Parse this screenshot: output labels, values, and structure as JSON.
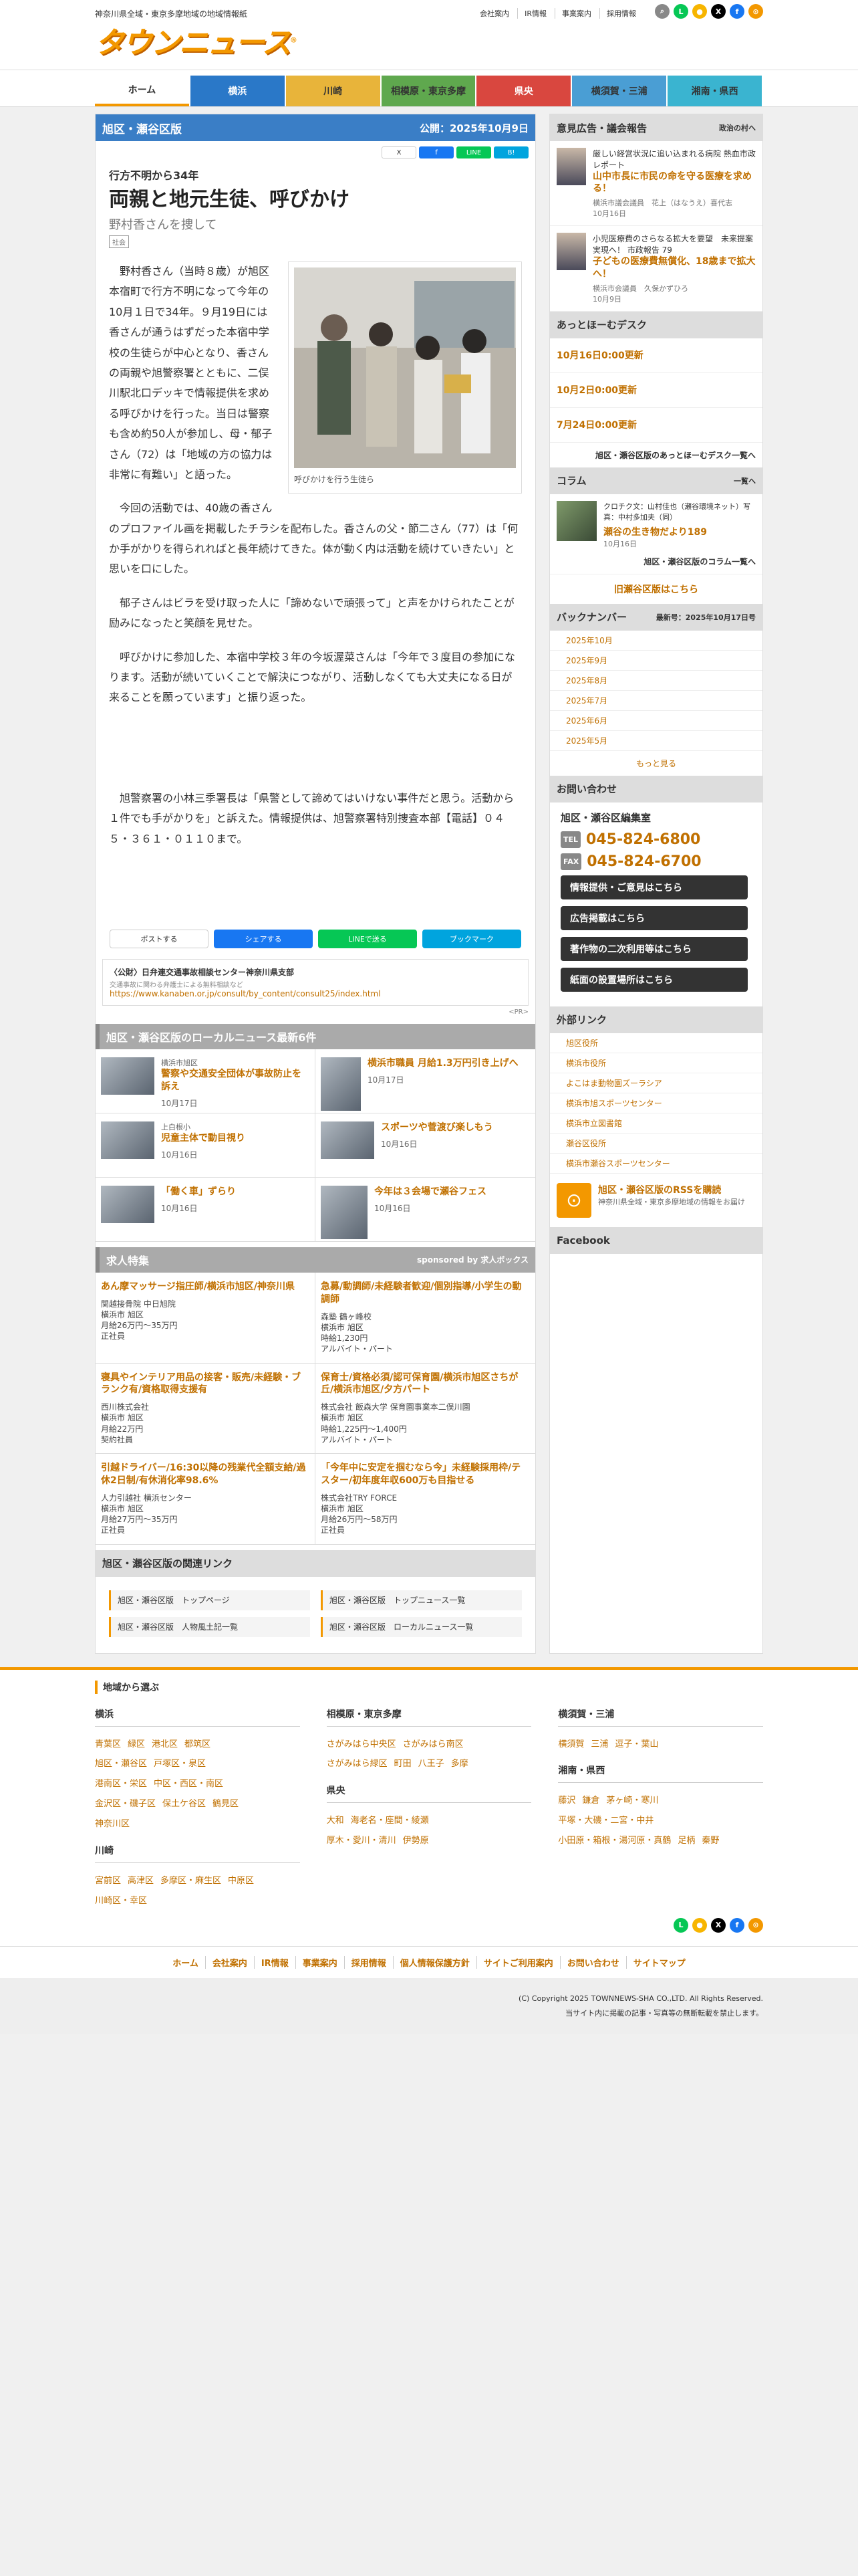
{
  "header": {
    "tagline": "神奈川県全域・東京多摩地域の地域情報紙",
    "logo": "タウンニュース",
    "logo_mark": "®",
    "links": [
      "会社案内",
      "IR情報",
      "事業案内",
      "採用情報"
    ]
  },
  "nav": {
    "items": [
      {
        "label": "ホーム",
        "color": "#ffffff"
      },
      {
        "label": "横浜",
        "color": "#2a78c8"
      },
      {
        "label": "川崎",
        "color": "#e8b43a"
      },
      {
        "label": "相模原・東京多摩",
        "color": "#5fa84e"
      },
      {
        "label": "県央",
        "color": "#d9473f"
      },
      {
        "label": "横須賀・三浦",
        "color": "#4a9ed4"
      },
      {
        "label": "湘南・県西",
        "color": "#3ab4d0"
      }
    ]
  },
  "article": {
    "edition": "旭区・瀬谷区版",
    "published": "公開：2025年10月9日",
    "share_mini": [
      "X",
      "f",
      "LINE",
      "B!"
    ],
    "subhead": "行方不明から34年",
    "title": "両親と地元生徒、呼びかけ",
    "lead": "野村香さんを捜して",
    "badge": "社会",
    "photo_caption": "呼びかけを行う生徒ら",
    "paragraphs": [
      "野村香さん（当時８歳）が旭区本宿町で行方不明になって今年の10月１日で34年。９月19日には香さんが通うはずだった本宿中学校の生徒らが中心となり、香さんの両親や旭警察署とともに、二俣川駅北口デッキで情報提供を求める呼びかけを行った。当日は警察も含め約50人が参加し、母・郁子さん（72）は「地域の方の協力は非常に有難い」と語った。",
      "今回の活動では、40歳の香さんのプロファイル画を掲載したチラシを配布した。香さんの父・節二さん（77）は「何か手がかりを得られればと長年続けてきた。体が動く内は活動を続けていきたい」と思いを口にした。",
      "郁子さんはビラを受け取った人に「諦めないで頑張って」と声をかけられたことが励みになったと笑顔を見せた。",
      "呼びかけに参加した、本宿中学校３年の今坂渥菜さんは「今年で３度目の参加になります。活動が続いていくことで解決につながり、活動しなくても大丈夫になる日が来ることを願っています」と振り返った。",
      "旭警察署の小林三季署長は「県警として諦めてはいけない事件だと思う。活動から１件でも手がかりを」と訴えた。情報提供は、旭警察署特別捜査本部【電話】０４５・３６１・０１１０まで。"
    ],
    "share_big": [
      "ポストする",
      "シェアする",
      "LINEで送る",
      "ブックマーク"
    ]
  },
  "ad": {
    "title": "〈公財〉日弁連交通事故相談センター神奈川県支部",
    "note": "交通事故に関わる弁護士による無料相談など",
    "url": "https://www.kanaben.or.jp/consult/by_content/consult25/index.html",
    "pr": "<PR>"
  },
  "local_news": {
    "heading": "旭区・瀬谷区版のローカルニュース最新6件",
    "items": [
      {
        "src": "横浜市旭区",
        "title": "警察や交通安全団体が事故防止を訴え",
        "date": "10月17日"
      },
      {
        "src": "",
        "title": "横浜市職員 月給1.3万円引き上げへ",
        "date": "10月17日"
      },
      {
        "src": "上白根小",
        "title": "児童主体で動目視り",
        "date": "10月16日"
      },
      {
        "src": "",
        "title": "スポーツや菅渡び楽しもう",
        "date": "10月16日"
      },
      {
        "src": "",
        "title": "「働く車」ずらり",
        "date": "10月16日"
      },
      {
        "src": "",
        "title": "今年は３会場で瀬谷フェス",
        "date": "10月16日"
      }
    ]
  },
  "jobs": {
    "heading": "求人特集",
    "sponsor": "sponsored by 求人ボックス",
    "items": [
      {
        "title": "あん摩マッサージ指圧師/横浜市旭区/神奈川県",
        "company": "関越接骨院 中日旭院",
        "loc": "横浜市 旭区",
        "pay": "月給26万円～35万円",
        "type": "正社員"
      },
      {
        "title": "急募/動調師/未経験者歓迎/個別指導/小学生の動調師",
        "company": "森塾 鶴ヶ峰校",
        "loc": "横浜市 旭区",
        "pay": "時給1,230円",
        "type": "アルバイト・パート"
      },
      {
        "title": "寝具やインテリア用品の接客・販売/未経験・ブランク有/資格取得支援有",
        "company": "西川株式会社",
        "loc": "横浜市 旭区",
        "pay": "月給22万円",
        "type": "契約社員"
      },
      {
        "title": "保育士/資格必須/認可保育園/横浜市旭区さちが丘/横浜市旭区/夕方パート",
        "company": "株式会社 飯森大学 保育園事業本二俣川園",
        "loc": "横浜市 旭区",
        "pay": "時給1,225円～1,400円",
        "type": "アルバイト・パート"
      },
      {
        "title": "引越ドライバー/16:30以降の残業代全額支給/過休2日制/有休消化率98.6%",
        "company": "人力引越社 横浜センター",
        "loc": "横浜市 旭区",
        "pay": "月給27万円～35万円",
        "type": "正社員"
      },
      {
        "title": "「今年中に安定を掴むなら今」未経験採用枠/テスター/初年度年収600万も目指せる",
        "company": "株式会社TRY FORCE",
        "loc": "横浜市 旭区",
        "pay": "月給26万円～58万円",
        "type": "正社員"
      }
    ]
  },
  "related": {
    "heading": "旭区・瀬谷区版の関連リンク",
    "links": [
      "旭区・瀬谷区版　トップページ",
      "旭区・瀬谷区版　トップニュース一覧",
      "旭区・瀬谷区版　人物風土記一覧",
      "旭区・瀬谷区版　ローカルニュース一覧"
    ]
  },
  "sidebar": {
    "opinion_head": "意見広告・議会報告",
    "opinion_more": "政治の村へ",
    "opinions": [
      {
        "t1": "厳しい経営状況に追い込まれる病院 熱血市政レポート",
        "t2": "山中市長に市民の命を守る医療を求める！",
        "t3": "横浜市議会議員　花上（はなうえ）喜代志",
        "t4": "10月16日"
      },
      {
        "t1": "小児医療費のさらなる拡大を要望　未来提案実現へ！ 市政報告 79",
        "t2": "子どもの医療費無償化、18歳まで拡大へ！",
        "t3": "横浜市会議員　久保かずひろ",
        "t4": "10月9日"
      }
    ],
    "desk_head": "あっとほーむデスク",
    "desk": [
      "10月16日0:00更新",
      "10月2日0:00更新",
      "7月24日0:00更新"
    ],
    "desk_link": "旭区・瀬谷区版のあっとほーむデスク一覧へ",
    "column_head": "コラム",
    "column_more": "一覧へ",
    "column": {
      "c1": "クロチク文：山村佳也（瀬谷環境ネット）写真：中村多加夫（同）",
      "c2": "瀬谷の生き物だより189",
      "c3": "10月16日"
    },
    "column_link": "旭区・瀬谷区版のコラム一覧へ",
    "edition_link": "旧瀬谷区版はこちら",
    "backnumber_head": "バックナンバー",
    "backnumber_latest": "最新号：2025年10月17日号",
    "backnumbers": [
      "2025年10月",
      "2025年9月",
      "2025年8月",
      "2025年7月",
      "2025年6月",
      "2025年5月"
    ],
    "backnumber_more": "もっと見る",
    "contact_head": "お問い合わせ",
    "contact_name": "旭区・瀬谷区編集室",
    "tel_label": "TEL",
    "tel": "045-824-6800",
    "fax_label": "FAX",
    "fax": "045-824-6700",
    "buttons": [
      "情報提供・ご意見はこちら",
      "広告掲載はこちら",
      "著作物の二次利用等はこちら",
      "紙面の設置場所はこちら"
    ],
    "ext_head": "外部リンク",
    "ext": [
      "旭区役所",
      "横浜市役所",
      "よこはま動物園ズーラシア",
      "横浜市旭スポーツセンター",
      "横浜市立図書館",
      "瀬谷区役所",
      "横浜市瀬谷スポーツセンター"
    ],
    "rss_title": "旭区・瀬谷区版のRSSを購読",
    "rss_sub": "神奈川県全域・東京多摩地域の情報をお届け",
    "facebook_head": "Facebook"
  },
  "footer": {
    "area_head": "地域から選ぶ",
    "cols": [
      {
        "groups": [
          {
            "title": "横浜",
            "links": [
              "青葉区",
              "緑区",
              "港北区",
              "都筑区",
              "旭区・瀬谷区",
              "戸塚区・泉区",
              "港南区・栄区",
              "中区・西区・南区",
              "金沢区・磯子区",
              "保土ケ谷区",
              "鶴見区",
              "神奈川区"
            ]
          },
          {
            "title": "川崎",
            "links": [
              "宮前区",
              "高津区",
              "多摩区・麻生区",
              "中原区",
              "川崎区・幸区"
            ]
          }
        ]
      },
      {
        "groups": [
          {
            "title": "相模原・東京多摩",
            "links": [
              "さがみはら中央区",
              "さがみはら南区",
              "さがみはら緑区",
              "町田",
              "八王子",
              "多摩"
            ]
          },
          {
            "title": "県央",
            "links": [
              "大和",
              "海老名・座間・綾瀬",
              "厚木・愛川・清川",
              "伊勢原"
            ]
          }
        ]
      },
      {
        "groups": [
          {
            "title": "横須賀・三浦",
            "links": [
              "横須賀",
              "三浦",
              "逗子・葉山"
            ]
          },
          {
            "title": "湘南・県西",
            "links": [
              "藤沢",
              "鎌倉",
              "茅ヶ崎・寒川",
              "平塚・大磯・二宮・中井",
              "小田原・箱根・湯河原・真鶴",
              "足柄",
              "秦野"
            ]
          }
        ]
      }
    ],
    "nav": [
      "ホーム",
      "会社案内",
      "IR情報",
      "事業案内",
      "採用情報",
      "個人情報保護方針",
      "サイトご利用案内",
      "お問い合わせ",
      "サイトマップ"
    ],
    "copyright": "(C) Copyright 2025 TOWNNEWS-SHA CO.,LTD. All Rights Reserved.",
    "notice": "当サイト内に掲載の記事・写真等の無断転載を禁止します。"
  }
}
